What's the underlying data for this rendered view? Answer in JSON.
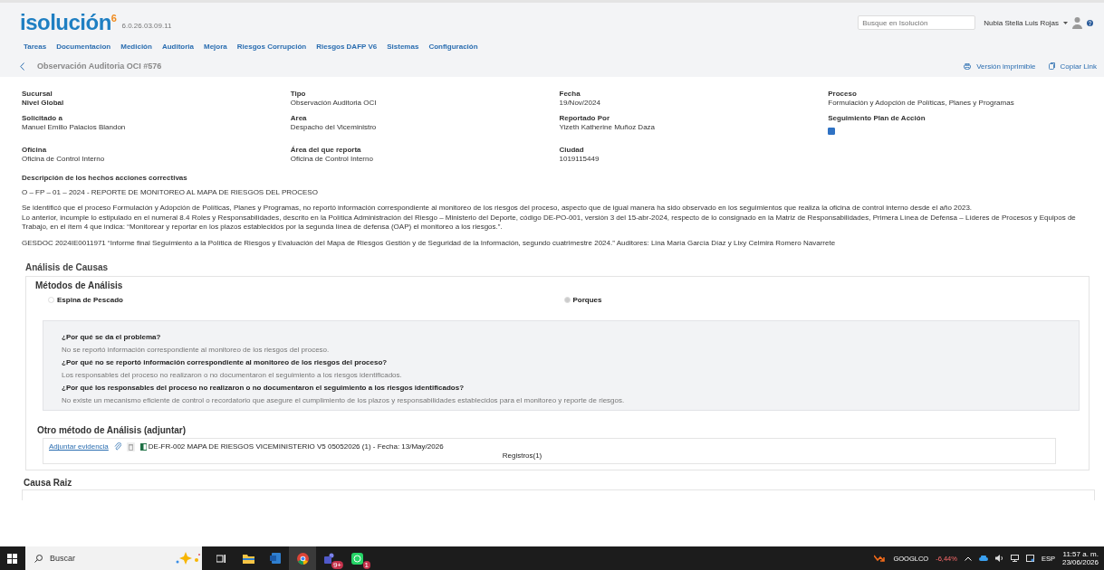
{
  "header": {
    "logo": "isolución",
    "logo_sup": "6",
    "version": "6.0.26.03.09.11",
    "search": {
      "placeholder": "Busque en Isolución"
    },
    "user": "Nubia Stella Luis Rojas"
  },
  "nav": [
    "Tareas",
    "Documentacion",
    "Medición",
    "Auditoria",
    "Mejora",
    "Riesgos Corrupción",
    "Riesgos DAFP V6",
    "Sistemas",
    "Configuración"
  ],
  "breadcrumb": {
    "title": "Observación Auditoria OCI #576",
    "actions": [
      {
        "kind": "print",
        "label": "Versión imprimible"
      },
      {
        "kind": "copy",
        "label": "Copiar Link"
      }
    ]
  },
  "fields": [
    {
      "label": "Sucursal",
      "value": "Nivel Global",
      "kind": "bold"
    },
    {
      "label": "Tipo",
      "value": "Observación Auditoria OCI",
      "kind": "text"
    },
    {
      "label": "Fecha",
      "value": "19/Nov/2024",
      "kind": "text"
    },
    {
      "label": "Proceso",
      "value": "Formulación y Adopción de Políticas, Planes y Programas",
      "kind": "text"
    },
    {
      "label": "Solicitado a",
      "value": "Manuel Emilio Palacios Blandon",
      "kind": "text"
    },
    {
      "label": "Area",
      "value": "Despacho del Viceministro",
      "kind": "text"
    },
    {
      "label": "Reportado Por",
      "value": "Yizeth Katherine Muñoz Daza",
      "kind": "text"
    },
    {
      "label": "Seguimiento Plan de Acción",
      "kind": "checkbox",
      "checked": true
    },
    {
      "label": "Oficina",
      "value": "Oficina de Control Interno",
      "kind": "text"
    },
    {
      "label": "Área del que reporta",
      "value": "Oficina de Control Interno",
      "kind": "text"
    },
    {
      "label": "Ciudad",
      "value": "1019115449",
      "kind": "text"
    }
  ],
  "description": {
    "title": "Descripción de los hechos acciones correctivas",
    "paragraphs": [
      "O – FP – 01 – 2024 - REPORTE DE MONITOREO AL MAPA DE RIESGOS DEL PROCESO",
      "Se identificó que el proceso Formulación y Adopción de Políticas, Planes y Programas, no reportó información correspondiente al monitoreo de los riesgos del proceso, aspecto que de igual manera ha sido observado en los seguimientos que realiza la oficina de control interno desde el año 2023.\nLo anterior, incumple lo estipulado en el numeral 8.4 Roles y Responsabilidades, descrito en la Política Administración del Riesgo – Ministerio del Deporte, código DE-PO-001, versión 3 del 15-abr-2024, respecto de lo consignado en la Matriz de Responsabilidades, Primera Línea de Defensa – Líderes de Procesos y Equipos de Trabajo, en el ítem 4 que indica: “Monitorear y reportar en los plazos establecidos por la segunda línea de defensa (OAP) el monitoreo a los riesgos.”.",
      "GESDOC 2024IE0011971 “Informe final Seguimiento a la Política de Riesgos y Evaluación del Mapa de Riesgos Gestión y de Seguridad de la Información, segundo cuatrimestre 2024.” Auditores: Lina María García Díaz y Lixy Celmira Romero Navarrete"
    ]
  },
  "analysis": {
    "title": "Análisis de Causas",
    "methods_title": "Métodos de Análisis",
    "methods": [
      {
        "label": "Espina de Pescado",
        "selected": false
      },
      {
        "label": "Porques",
        "selected": true
      }
    ],
    "whys": [
      {
        "question": "¿Por qué se da el problema?",
        "answer": "No se reportó información correspondiente al monitoreo de los riesgos del proceso."
      },
      {
        "question": "¿Por qué no se reportó información correspondiente al monitoreo de los riesgos del proceso?",
        "answer": "Los responsables del proceso no realizaron o no documentaron el seguimiento a los riesgos identificados."
      },
      {
        "question": "¿Por qué los responsables del proceso no realizaron o no documentaron el seguimiento a los riesgos identificados?",
        "answer": "No existe un mecanismo eficiente de control o recordatorio que asegure el cumplimiento de los plazos y responsabilidades establecidos para el monitoreo y reporte de riesgos."
      }
    ],
    "other_title": "Otro método de Análisis (adjuntar)",
    "attach_link": "Adjuntar evidencia",
    "file": "DE-FR-002 MAPA DE RIESGOS VICEMINISTERIO V5 05052026 (1) - Fecha: 13/May/2026",
    "records": "Registros(1)",
    "root_title": "Causa Raiz"
  },
  "taskbar": {
    "search": "Buscar",
    "apps": [
      {
        "kind": "taskview"
      },
      {
        "kind": "folder"
      },
      {
        "kind": "word"
      },
      {
        "kind": "chrome",
        "selected": true
      },
      {
        "kind": "teams",
        "badge": "9+"
      },
      {
        "kind": "whatsapp",
        "badge": "1"
      }
    ],
    "stock": "GOOGLCO",
    "change": "-6,44%",
    "lang": "ESP",
    "time": "11:57 a. m.",
    "date": "23/06/2026"
  }
}
